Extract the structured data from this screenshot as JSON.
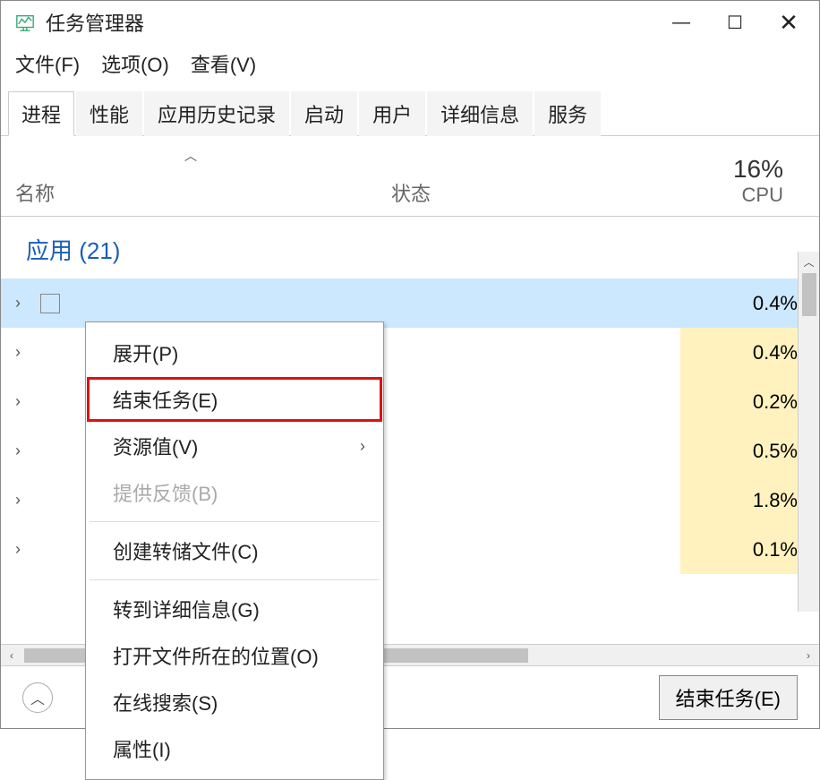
{
  "window": {
    "title": "任务管理器"
  },
  "menubar": {
    "file": "文件(F)",
    "options": "选项(O)",
    "view": "查看(V)"
  },
  "tabs": {
    "processes": "进程",
    "performance": "性能",
    "app_history": "应用历史记录",
    "startup": "启动",
    "users": "用户",
    "details": "详细信息",
    "services": "服务"
  },
  "columns": {
    "name": "名称",
    "status": "状态",
    "cpu_pct": "16%",
    "cpu_label": "CPU"
  },
  "group": {
    "label": "应用 (21)"
  },
  "rows": [
    {
      "cpu": "0.4%"
    },
    {
      "cpu": "0.4%"
    },
    {
      "cpu": "0.2%"
    },
    {
      "cpu": "0.5%"
    },
    {
      "cpu": "1.8%"
    },
    {
      "cpu": "0.1%"
    }
  ],
  "context_menu": {
    "expand": "展开(P)",
    "end_task": "结束任务(E)",
    "resource_values": "资源值(V)",
    "provide_feedback": "提供反馈(B)",
    "create_dump": "创建转储文件(C)",
    "go_to_details": "转到详细信息(G)",
    "open_file_location": "打开文件所在的位置(O)",
    "search_online": "在线搜索(S)",
    "properties": "属性(I)"
  },
  "footer": {
    "end_task_button": "结束任务(E)"
  }
}
